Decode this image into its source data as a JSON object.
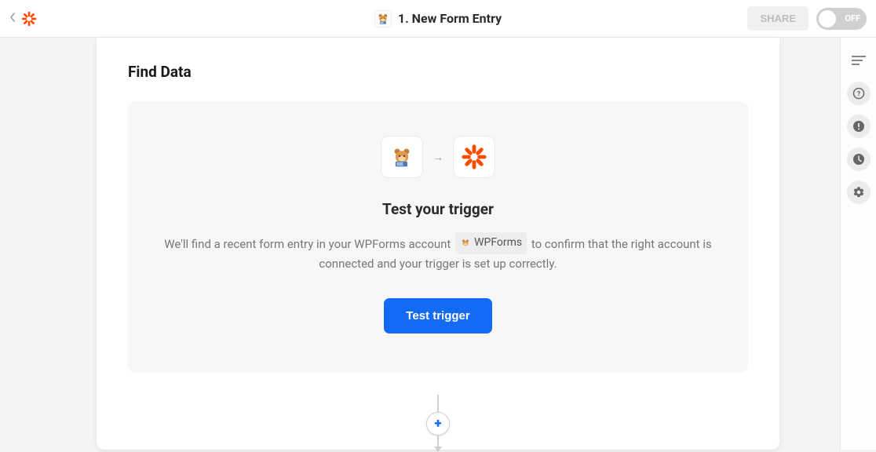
{
  "header": {
    "step_title": "1. New Form Entry",
    "share_label": "SHARE",
    "toggle_label": "OFF"
  },
  "main": {
    "section_title": "Find Data",
    "panel_heading": "Test your trigger",
    "desc_part1": "We'll find a recent form entry in your WPForms account ",
    "account_chip_label": "WPForms",
    "desc_part2": " to confirm that the right account is connected and your trigger is set up correctly.",
    "primary_button_label": "Test trigger"
  },
  "icons": {
    "source": "wpforms-icon",
    "target": "zapier-icon",
    "arrow": "→"
  },
  "sidebar": {
    "items": [
      {
        "name": "outline-icon"
      },
      {
        "name": "help-icon"
      },
      {
        "name": "alert-icon"
      },
      {
        "name": "history-icon"
      },
      {
        "name": "settings-icon"
      }
    ]
  }
}
